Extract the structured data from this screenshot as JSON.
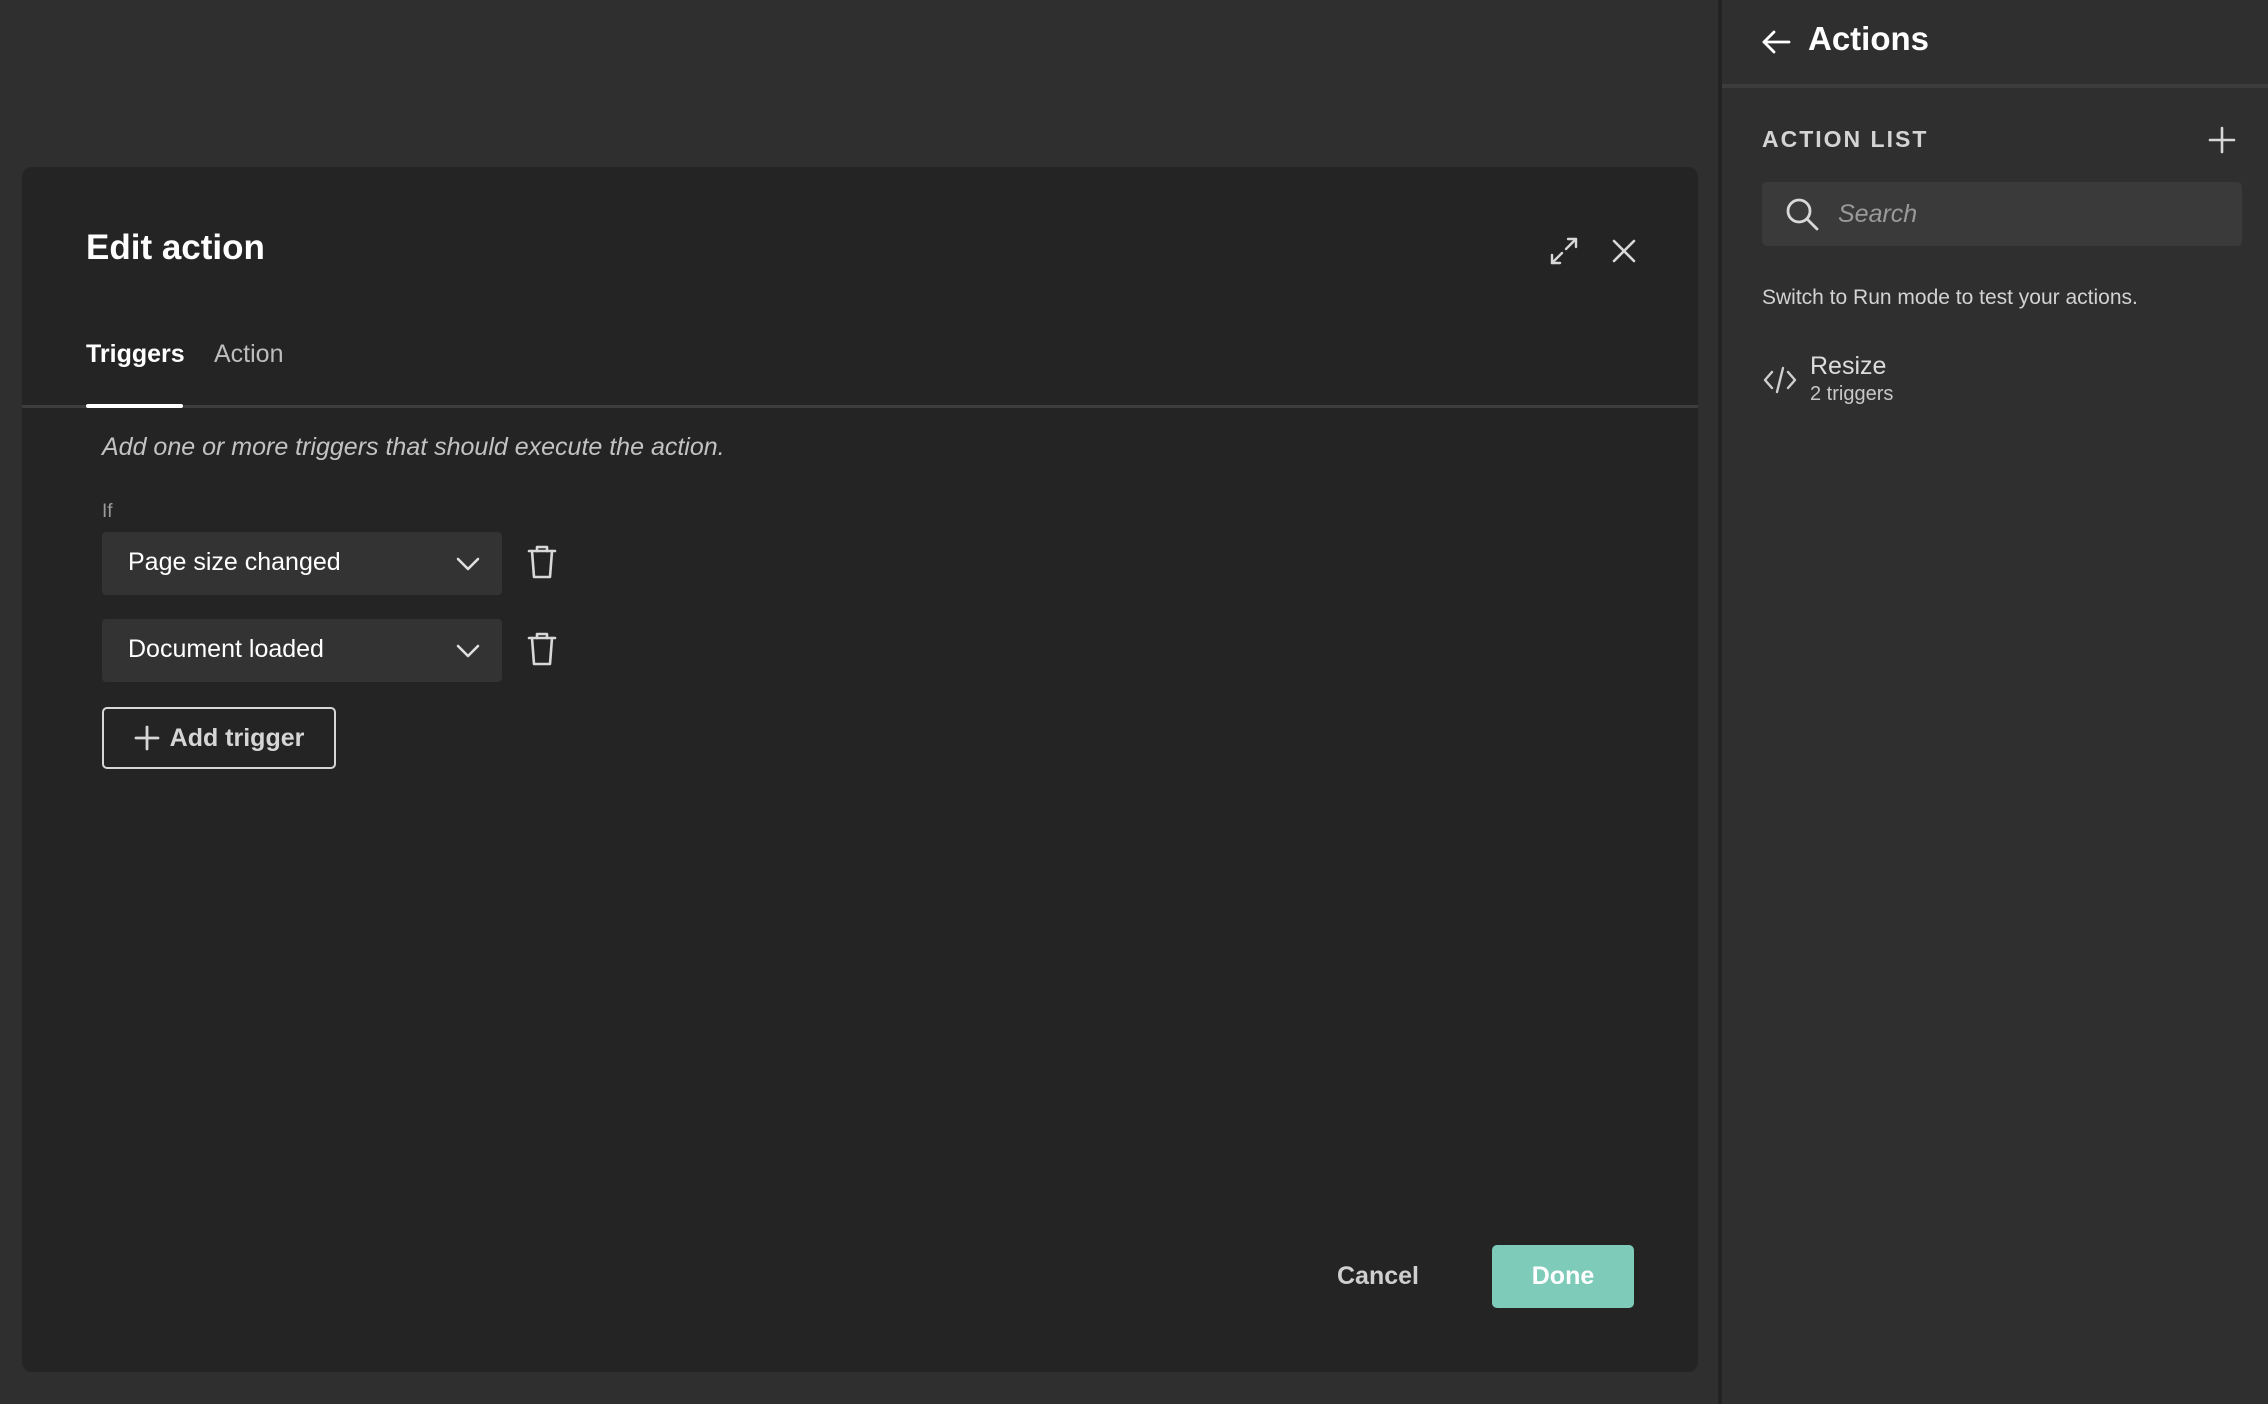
{
  "modal": {
    "title": "Edit action",
    "tabs": [
      {
        "label": "Triggers",
        "active": true
      },
      {
        "label": "Action",
        "active": false
      }
    ],
    "hint": "Add one or more triggers that should execute the action.",
    "if_label": "If",
    "triggers": [
      {
        "value": "Page size changed"
      },
      {
        "value": "Document loaded"
      }
    ],
    "add_trigger_label": "Add trigger",
    "cancel_label": "Cancel",
    "done_label": "Done"
  },
  "panel": {
    "title": "Actions",
    "section_title": "ACTION LIST",
    "search": {
      "placeholder": "Search",
      "value": ""
    },
    "run_hint": "Switch to Run mode to test your actions.",
    "actions": [
      {
        "name": "Resize",
        "subtitle": "2 triggers"
      }
    ]
  },
  "colors": {
    "background": "#2f2f2f",
    "modal": "#242424",
    "select": "#333333",
    "accent": "#7ecbb9"
  }
}
